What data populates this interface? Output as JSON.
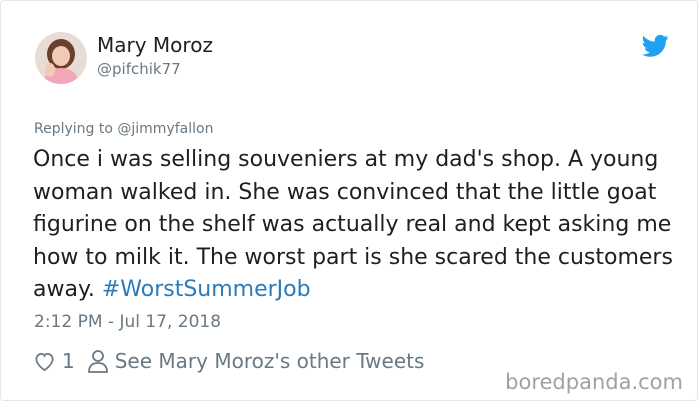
{
  "author": {
    "name": "Mary Moroz",
    "handle": "@pifchik77"
  },
  "tweet": {
    "reply_prefix": "Replying to",
    "reply_to": "@jimmyfallon",
    "text": "Once i was selling souveniers at my dad's shop. A young woman walked in. She was convinced that the little goat figurine on the shelf was actually real and kept asking me how to milk it. The worst part is she scared the customers away.",
    "hashtag": "#WorstSummerJob",
    "timestamp": "2:12 PM - Jul 17, 2018"
  },
  "actions": {
    "like_count": "1",
    "other_tweets_label": "See Mary Moroz's other Tweets"
  },
  "watermark": "boredpanda.com",
  "colors": {
    "link": "#2b7bb9",
    "twitter_blue": "#1da1f2",
    "muted": "#697882"
  },
  "icons": [
    "twitter-bird-icon",
    "heart-icon",
    "person-icon"
  ]
}
